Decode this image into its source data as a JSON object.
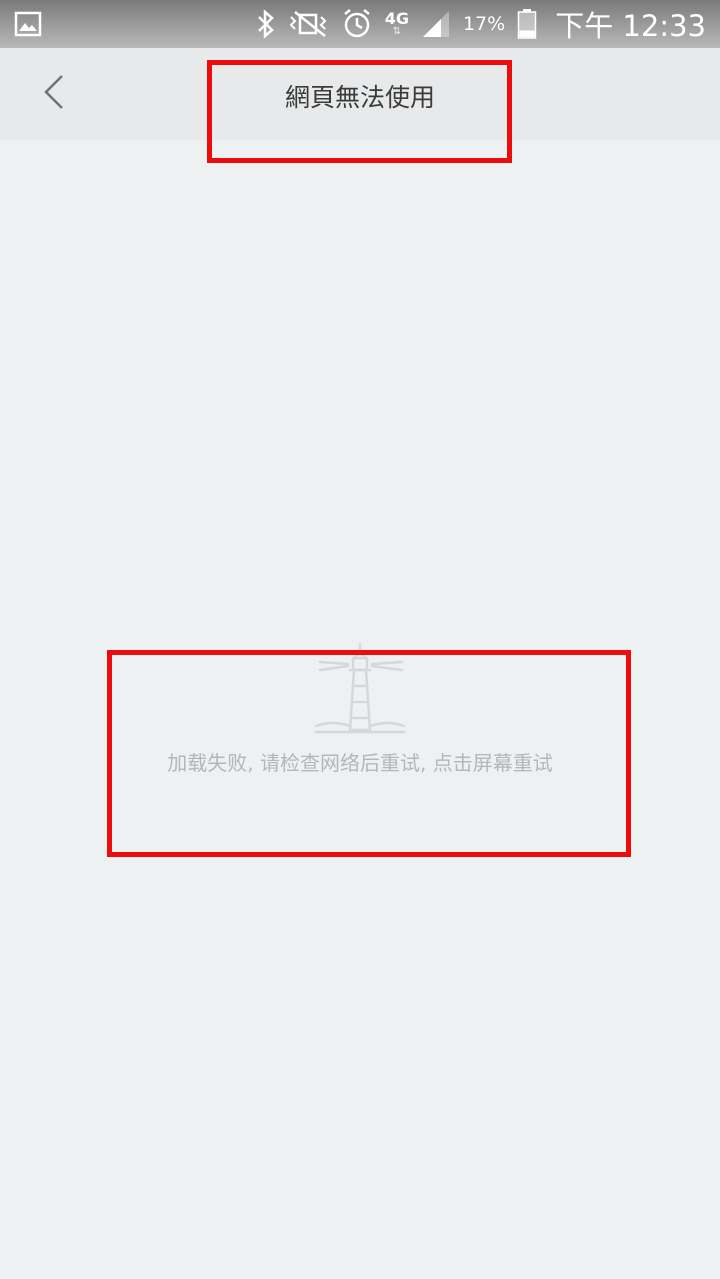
{
  "status_bar": {
    "network_type": "4G",
    "battery_percent": "17%",
    "time": "下午 12:33",
    "battery_level": 0.17,
    "icons": [
      "gallery-icon",
      "bluetooth-icon",
      "vibrate-icon",
      "alarm-icon",
      "network-arrows-icon",
      "signal-icon",
      "battery-icon"
    ]
  },
  "toolbar": {
    "title": "網頁無法使用",
    "back_icon": "chevron-left-icon"
  },
  "error": {
    "icon": "lighthouse-icon",
    "message": "加载失败, 请检查网络后重试, 点击屏幕重试"
  },
  "colors": {
    "background": "#eef1f2",
    "toolbar": "#e7e9ea",
    "annotation": "#ee0b0b",
    "error_text": "#b3b7ba",
    "title_text": "#3b3b3b"
  }
}
